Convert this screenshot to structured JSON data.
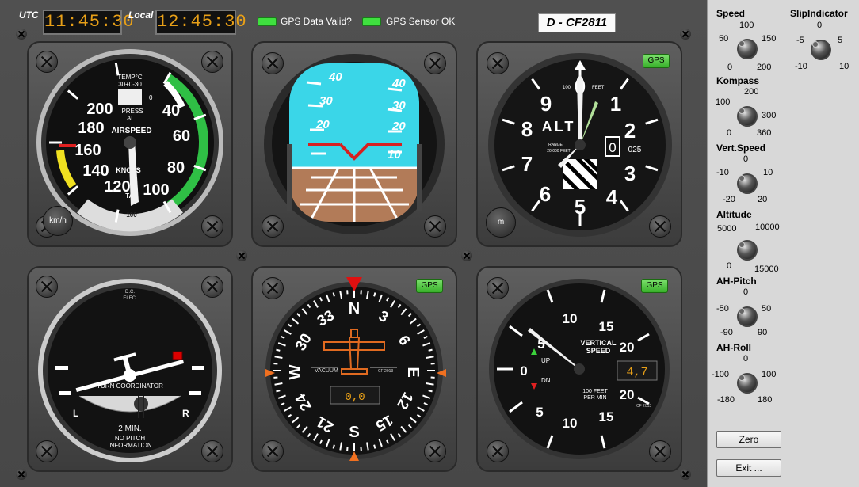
{
  "header": {
    "utc_label": "UTC",
    "utc_time": "11:45:30",
    "local_label": "Local",
    "local_time": "12:45:30",
    "gps_data_valid_label": "GPS Data Valid?",
    "gps_sensor_ok_label": "GPS Sensor OK",
    "registration": "D - CF2811"
  },
  "airspeed": {
    "title": "AIRSPEED",
    "subtitle": "KNOTS",
    "temp_label": "TEMP°C",
    "temp_scale": "30+0-30",
    "press_label": "PRESS",
    "alt_label": "ALT",
    "tas_label": "TAS",
    "tas_value": "100",
    "tas_zero": "0",
    "unit_button": "km/h",
    "ticks": [
      "40",
      "60",
      "80",
      "100",
      "120",
      "140",
      "160",
      "180",
      "200"
    ]
  },
  "attitude": {
    "pitch_marks": [
      "40",
      "30",
      "20",
      "10"
    ]
  },
  "altimeter": {
    "gps_button": "GPS",
    "title": "ALT",
    "range_label": "RANGE",
    "range_value": "20,000 FEET",
    "hundred_label": "100",
    "feet_label": "FEET",
    "ticks": [
      "0",
      "1",
      "2",
      "3",
      "4",
      "5",
      "6",
      "7",
      "8",
      "9"
    ],
    "drum_value": "0",
    "baro_value": "025",
    "unit_button": "m"
  },
  "turn_coordinator": {
    "dc_label": "D.C.",
    "elec_label": "ELEC.",
    "title": "TURN COORDINATOR",
    "left": "L",
    "right": "R",
    "minutes": "2 MIN.",
    "no_pitch": "NO PITCH",
    "information": "INFORMATION"
  },
  "heading": {
    "gps_button": "GPS",
    "labels": [
      "N",
      "3",
      "6",
      "E",
      "12",
      "15",
      "S",
      "21",
      "24",
      "W",
      "30",
      "33"
    ],
    "vacuum_label": "VACUUM",
    "cf_label": "CF 2013",
    "digital": "0,0"
  },
  "vertical_speed": {
    "gps_button": "GPS",
    "title_1": "VERTICAL",
    "title_2": "SPEED",
    "up": "UP",
    "dn": "DN",
    "unit_1": "100 FEET",
    "unit_2": "PER MIN",
    "cf_label": "CF 2013",
    "ticks": [
      "5",
      "10",
      "15",
      "20",
      "0",
      "5",
      "10",
      "15",
      "20"
    ],
    "digital": "4,7"
  },
  "controls": {
    "speed": {
      "label": "Speed",
      "t0": "100",
      "tl": "50",
      "tr": "150",
      "bl": "0",
      "br": "200"
    },
    "slip": {
      "label": "SlipIndicator",
      "t0": "0",
      "tl": "-5",
      "tr": "5",
      "bl": "-10",
      "br": "10"
    },
    "kompass": {
      "label": "Kompass",
      "t0": "200",
      "tl": "100",
      "tr": "300",
      "bl": "0",
      "br": "360"
    },
    "vspeed": {
      "label": "Vert.Speed",
      "t0": "0",
      "tl": "-10",
      "tr": "10",
      "bl": "-20",
      "br": "20"
    },
    "altitude": {
      "label": "Altitude",
      "tl": "5000",
      "tr": "10000",
      "bl": "0",
      "br": "15000"
    },
    "pitch": {
      "label": "AH-Pitch",
      "t0": "0",
      "tl": "-50",
      "tr": "50",
      "bl": "-90",
      "br": "90"
    },
    "roll": {
      "label": "AH-Roll",
      "t0": "0",
      "tl": "-100",
      "tr": "100",
      "bl": "-180",
      "br": "180"
    },
    "zero_button": "Zero",
    "exit_button": "Exit ..."
  }
}
